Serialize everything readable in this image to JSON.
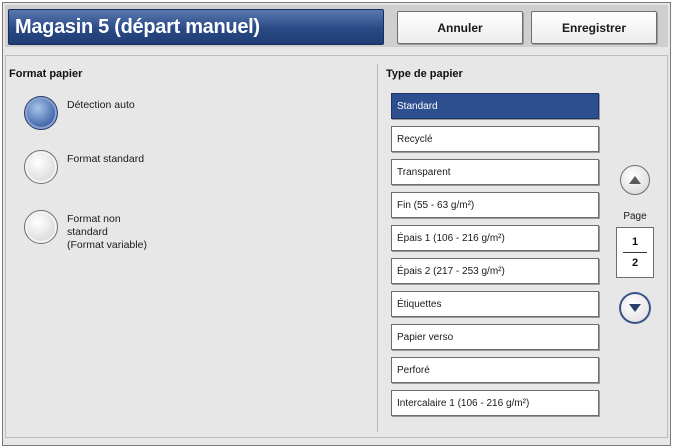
{
  "header": {
    "title": "Magasin 5 (départ manuel)",
    "cancel_label": "Annuler",
    "save_label": "Enregistrer"
  },
  "paper_size": {
    "label": "Format papier",
    "options": [
      {
        "label": "Détection auto",
        "selected": true
      },
      {
        "label": "Format standard",
        "selected": false
      },
      {
        "label": "Format non\nstandard\n(Format variable)",
        "selected": false
      }
    ]
  },
  "paper_type": {
    "label": "Type de papier",
    "items": [
      "Standard",
      "Recyclé",
      "Transparent",
      "Fin (55 - 63 g/m²)",
      "Épais 1 (106 - 216 g/m²)",
      "Épais 2 (217 - 253 g/m²)",
      "Étiquettes",
      "Papier verso",
      "Perforé",
      "Intercalaire 1 (106 - 216 g/m²)"
    ],
    "selected_index": 0
  },
  "pagination": {
    "label": "Page",
    "current": "1",
    "total": "2"
  },
  "colors": {
    "title_bar": "#2a4a86",
    "selected_item": "#2e4f8f"
  }
}
